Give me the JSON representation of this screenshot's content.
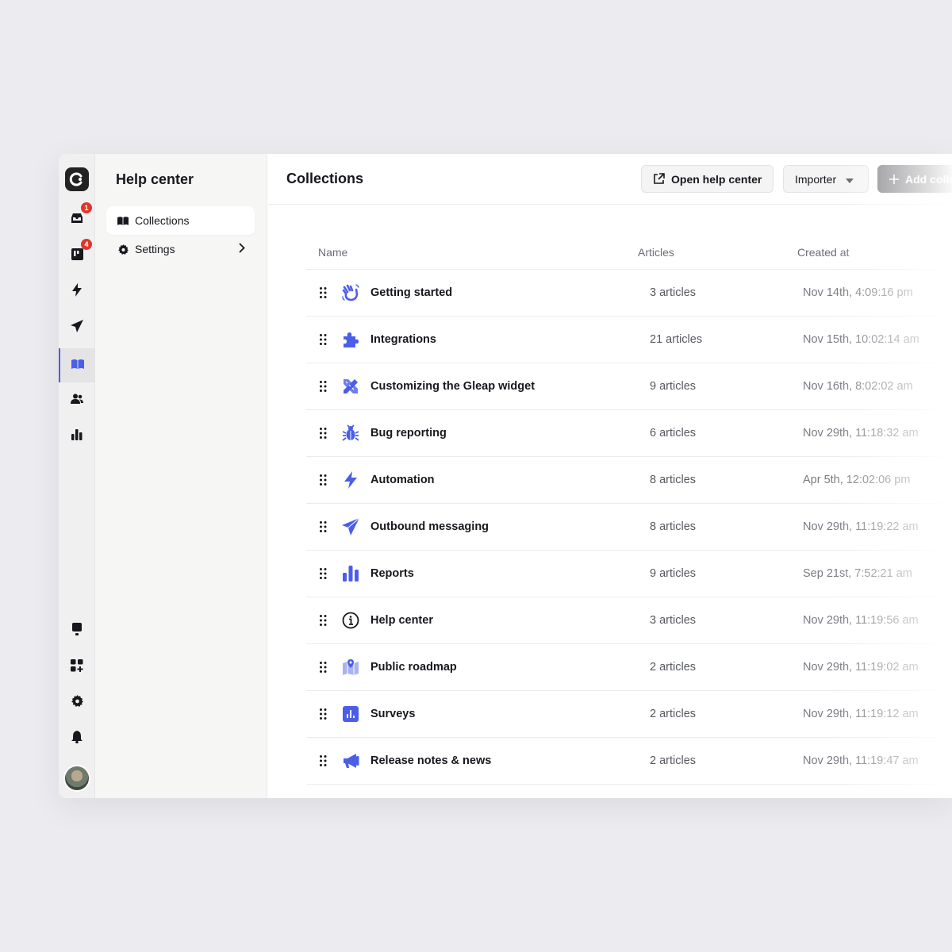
{
  "rail": {
    "badges": {
      "inbox": "1",
      "board": "4"
    }
  },
  "sidebar": {
    "title": "Help center",
    "items": [
      {
        "label": "Collections",
        "icon": "book-icon"
      },
      {
        "label": "Settings",
        "icon": "gear-icon"
      }
    ]
  },
  "header": {
    "title": "Collections",
    "open_label": "Open help center",
    "importer_label": "Importer",
    "add_label": "Add colle"
  },
  "table": {
    "columns": [
      "Name",
      "Articles",
      "Created at"
    ],
    "rows": [
      {
        "name": "Getting started",
        "articles": "3 articles",
        "created": "Nov 14th, 4:09:16 pm",
        "icon": "wave-hand-icon"
      },
      {
        "name": "Integrations",
        "articles": "21 articles",
        "created": "Nov 15th, 10:02:14 am",
        "icon": "puzzle-icon"
      },
      {
        "name": "Customizing the Gleap widget",
        "articles": "9 articles",
        "created": "Nov 16th, 8:02:02 am",
        "icon": "pencil-ruler-icon"
      },
      {
        "name": "Bug reporting",
        "articles": "6 articles",
        "created": "Nov 29th, 11:18:32 am",
        "icon": "bug-icon"
      },
      {
        "name": "Automation",
        "articles": "8 articles",
        "created": "Apr 5th, 12:02:06 pm",
        "icon": "bolt-icon"
      },
      {
        "name": "Outbound messaging",
        "articles": "8 articles",
        "created": "Nov 29th, 11:19:22 am",
        "icon": "paper-plane-icon"
      },
      {
        "name": "Reports",
        "articles": "9 articles",
        "created": "Sep 21st, 7:52:21 am",
        "icon": "bar-chart-icon"
      },
      {
        "name": "Help center",
        "articles": "3 articles",
        "created": "Nov 29th, 11:19:56 am",
        "icon": "info-circle-icon"
      },
      {
        "name": "Public roadmap",
        "articles": "2 articles",
        "created": "Nov 29th, 11:19:02 am",
        "icon": "map-icon"
      },
      {
        "name": "Surveys",
        "articles": "2 articles",
        "created": "Nov 29th, 11:19:12 am",
        "icon": "survey-chart-icon"
      },
      {
        "name": "Release notes & news",
        "articles": "2 articles",
        "created": "Nov 29th, 11:19:47 am",
        "icon": "megaphone-icon"
      }
    ]
  },
  "colors": {
    "accent": "#4b5ee8",
    "badge": "#e0362c"
  }
}
